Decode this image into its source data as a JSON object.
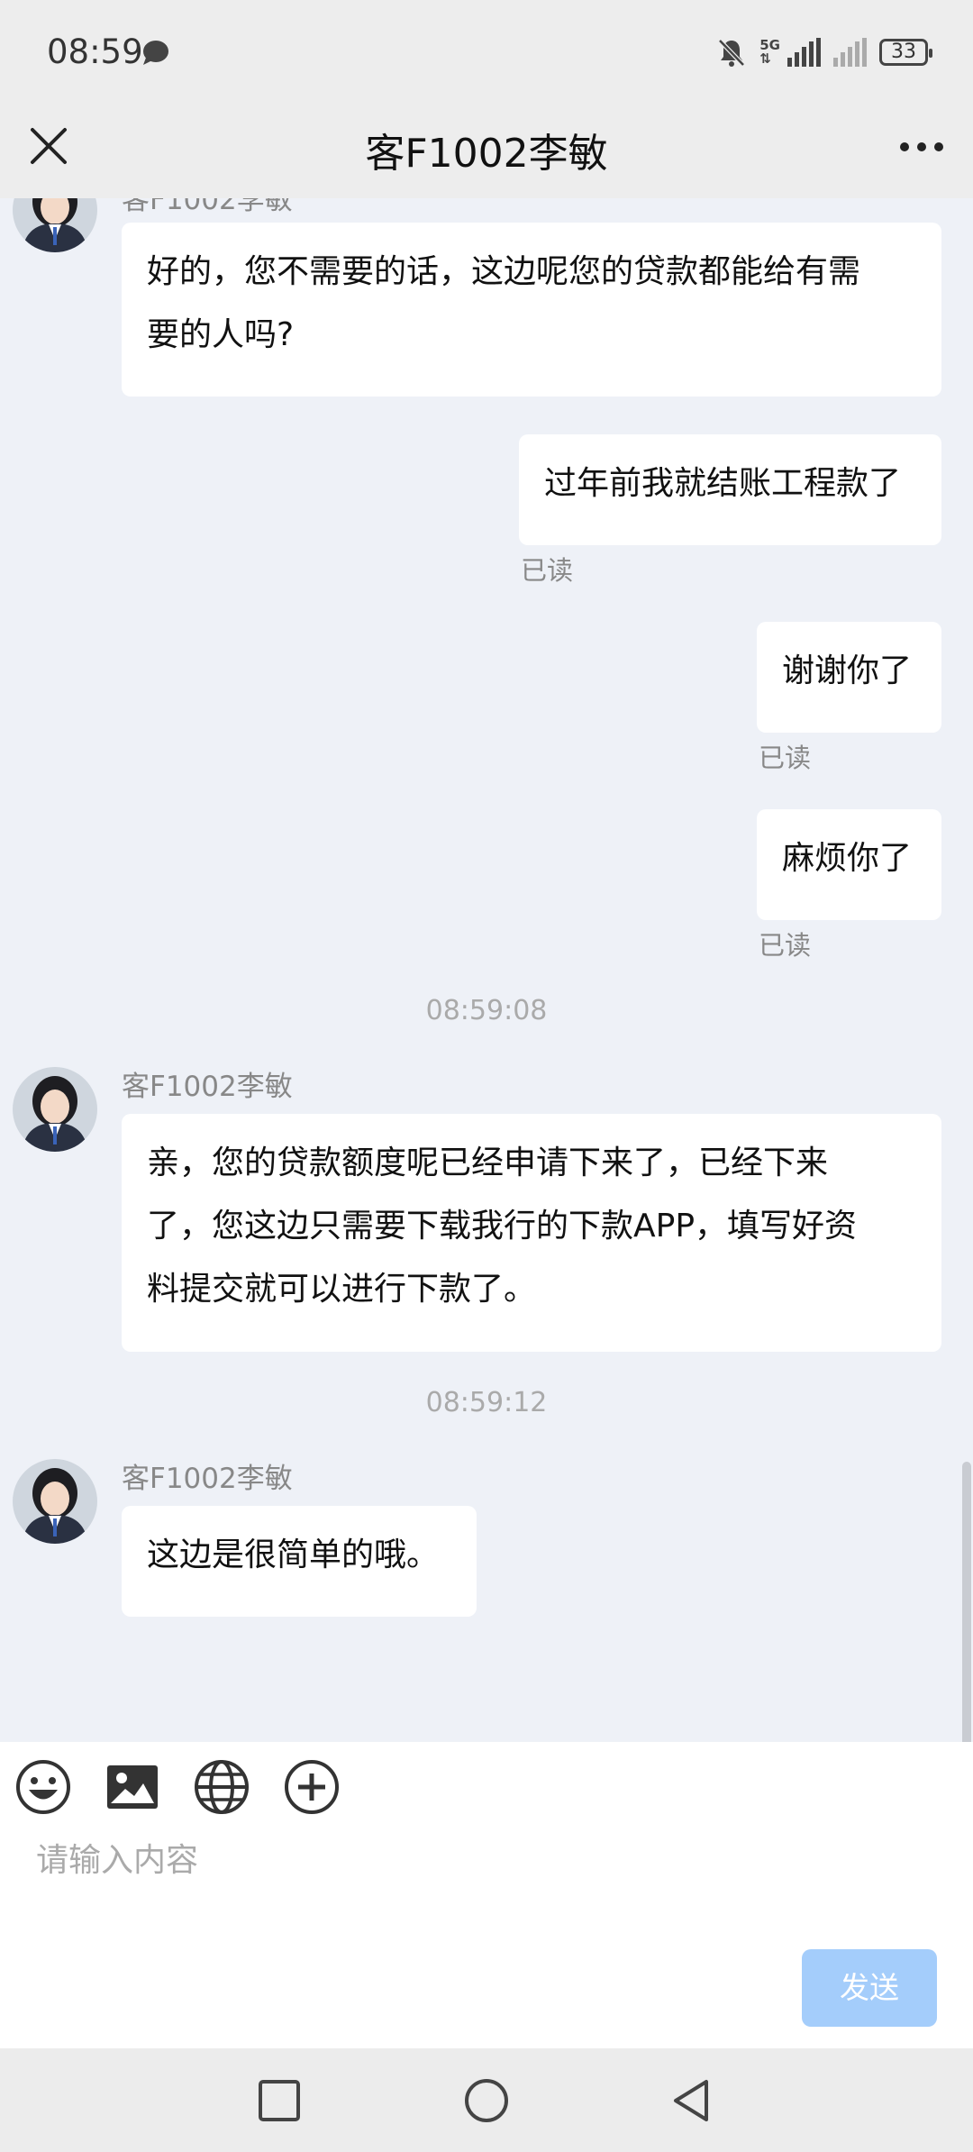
{
  "status": {
    "time": "08:59",
    "net_top": "5G",
    "net_bottom": "⇅",
    "battery": "33"
  },
  "header": {
    "title": "客F1002李敏"
  },
  "messages": {
    "partial_sender": "客F1002李敏",
    "msg1_line1": "好的，您不需要的话，这边呢您的贷款都能给有需",
    "msg1_line2": "要的人吗?",
    "msg2": "过年前我就结账工程款了",
    "msg2_read": "已读",
    "msg3": "谢谢你了",
    "msg3_read": "已读",
    "msg4": "麻烦你了",
    "msg4_read": "已读",
    "ts1": "08:59:08",
    "sender1": "客F1002李敏",
    "msg5_line1": "亲，您的贷款额度呢已经申请下来了，已经下来",
    "msg5_line2": "了，您这边只需要下载我行的下款APP，填写好资",
    "msg5_line3": "料提交就可以进行下款了。",
    "ts2": "08:59:12",
    "sender2": "客F1002李敏",
    "msg6": "这边是很简单的哦。"
  },
  "composer": {
    "placeholder": "请输入内容",
    "send_label": "发送"
  },
  "icons": [
    "close-icon",
    "more-icon",
    "emoji-icon",
    "image-icon",
    "globe-icon",
    "plus-circle-icon",
    "square-icon",
    "circle-icon",
    "back-triangle-icon"
  ],
  "colors": {
    "send_button": "#a4cdfb",
    "chat_background": "#eef1f7",
    "header_background": "#ededed"
  }
}
